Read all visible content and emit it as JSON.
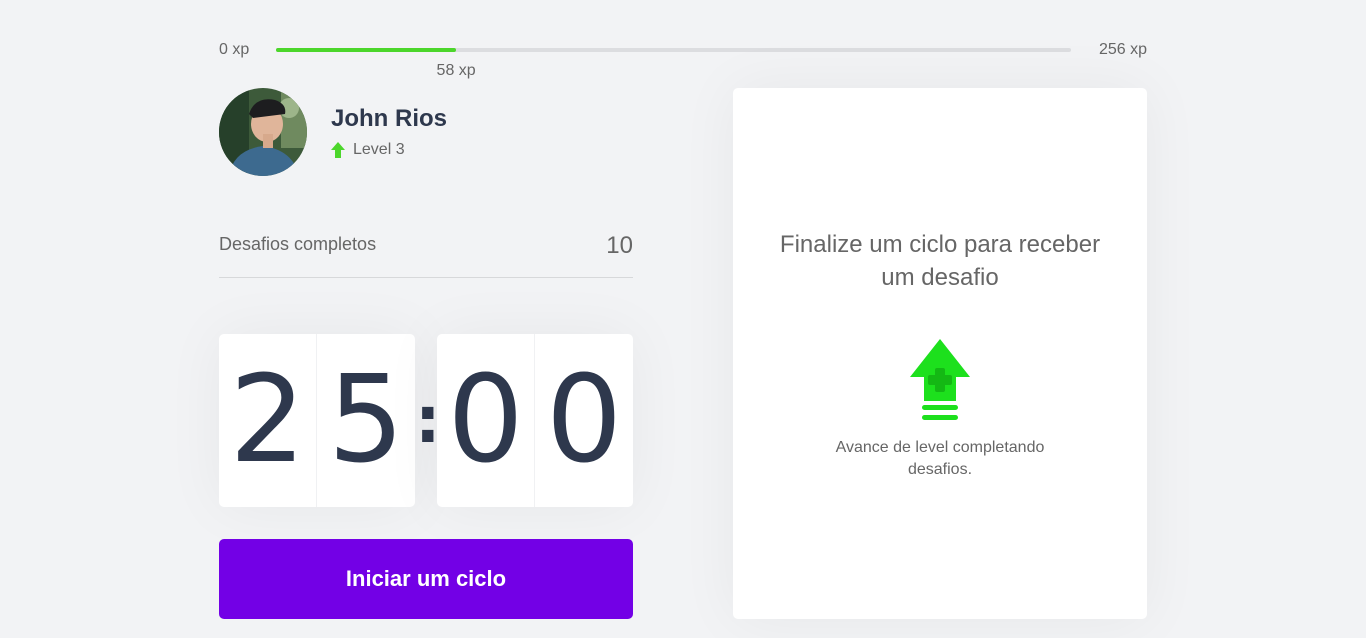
{
  "xp": {
    "min_label": "0 xp",
    "max_label": "256 xp",
    "current_label": "58 xp",
    "current": 58,
    "max": 256,
    "accent_color": "#4cd62b"
  },
  "profile": {
    "name": "John Rios",
    "level_label": "Level 3",
    "level_icon": "level-up-arrow-icon"
  },
  "completed": {
    "label": "Desafios completos",
    "value": "10"
  },
  "countdown": {
    "minutes": [
      "2",
      "5"
    ],
    "separator": ":",
    "seconds": [
      "0",
      "0"
    ]
  },
  "actions": {
    "start_cycle_label": "Iniciar um ciclo",
    "button_color": "#7300e6"
  },
  "challenge": {
    "title": "Finalize um ciclo para receber um desafio",
    "hint": "Avance de level completando desafios.",
    "icon": "level-up-icon"
  }
}
